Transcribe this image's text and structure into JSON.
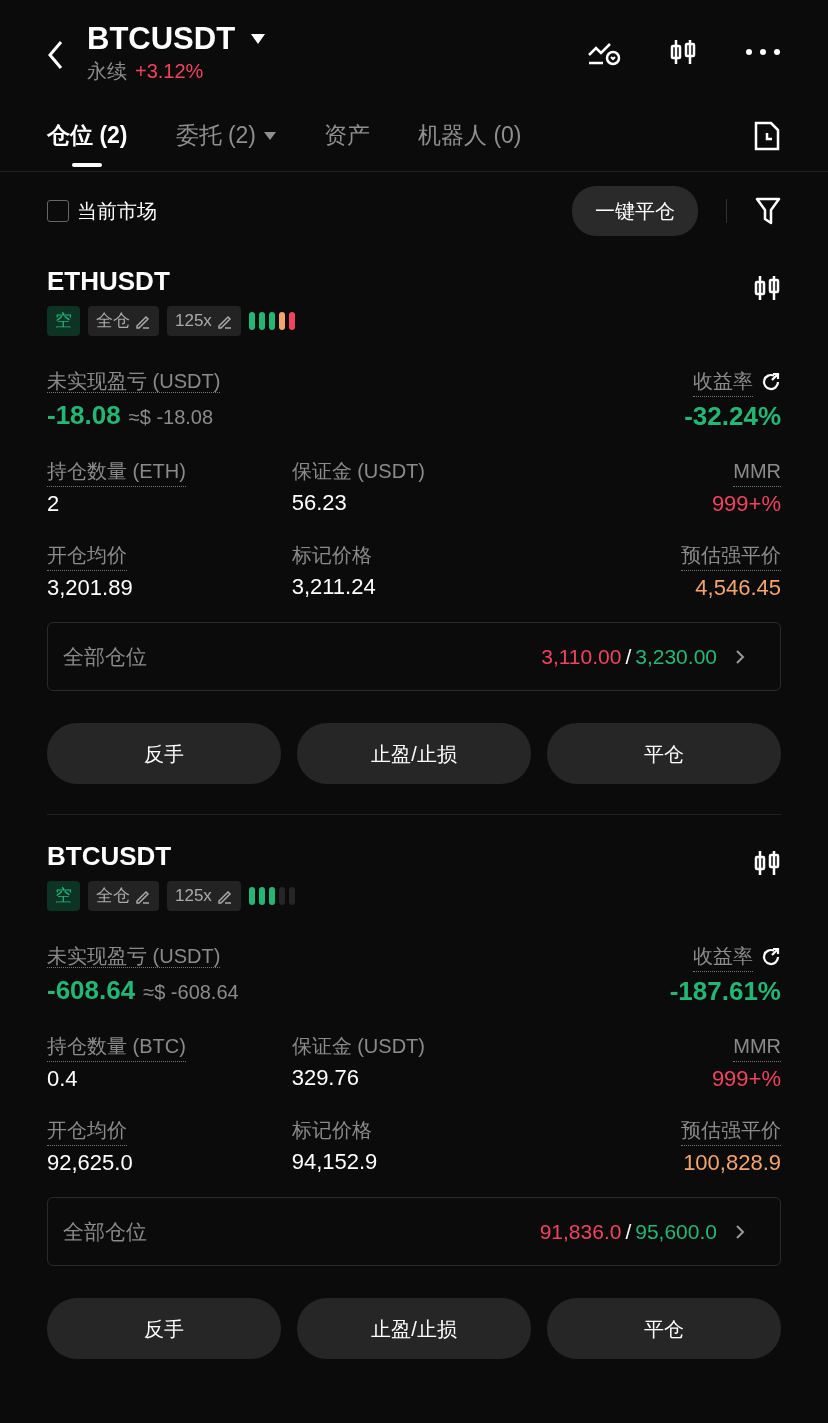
{
  "header": {
    "symbol": "BTCUSDT",
    "contract_type": "永续",
    "change": "+3.12%"
  },
  "tabs": [
    {
      "label": "仓位 (2)",
      "selected": true,
      "dropdown": false
    },
    {
      "label": "委托 (2)",
      "selected": false,
      "dropdown": true
    },
    {
      "label": "资产",
      "selected": false,
      "dropdown": false
    },
    {
      "label": "机器人 (0)",
      "selected": false,
      "dropdown": false
    }
  ],
  "filter_bar": {
    "checkbox_label": "当前市场",
    "checked": false,
    "close_all_button": "一键平仓"
  },
  "positions": [
    {
      "symbol": "ETHUSDT",
      "side": "空",
      "margin_mode": "全仓",
      "leverage": "125x",
      "risk_bars": [
        {
          "color": "#24b675"
        },
        {
          "color": "#24b675"
        },
        {
          "color": "#24b675"
        },
        {
          "color": "#f4a46e"
        },
        {
          "color": "#f0435f"
        }
      ],
      "pnl_label": "未实现盈亏 (USDT)",
      "pnl": "-18.08",
      "pnl_usd": "≈$ -18.08",
      "roe_label": "收益率",
      "roe": "-32.24%",
      "stats": [
        {
          "label": "持仓数量 (ETH)",
          "value": "2",
          "dotted": true,
          "color": "#ffffff"
        },
        {
          "label": "保证金 (USDT)",
          "value": "56.23",
          "dotted": false,
          "color": "#ffffff"
        },
        {
          "label": "MMR",
          "value": "999+%",
          "dotted": true,
          "color": "#f0435f"
        },
        {
          "label": "开仓均价",
          "value": "3,201.89",
          "dotted": true,
          "color": "#ffffff"
        },
        {
          "label": "标记价格",
          "value": "3,211.24",
          "dotted": false,
          "color": "#ffffff"
        },
        {
          "label": "预估强平价",
          "value": "4,546.45",
          "dotted": true,
          "color": "#f4a46e"
        }
      ],
      "range": {
        "label": "全部仓位",
        "low": "3,110.00",
        "separator": "/",
        "high": "3,230.00"
      },
      "buttons": [
        "反手",
        "止盈/止损",
        "平仓"
      ]
    },
    {
      "symbol": "BTCUSDT",
      "side": "空",
      "margin_mode": "全仓",
      "leverage": "125x",
      "risk_bars": [
        {
          "color": "#24b675"
        },
        {
          "color": "#24b675"
        },
        {
          "color": "#24b675"
        },
        {
          "color": "#262626"
        },
        {
          "color": "#262626"
        }
      ],
      "pnl_label": "未实现盈亏 (USDT)",
      "pnl": "-608.64",
      "pnl_usd": "≈$ -608.64",
      "roe_label": "收益率",
      "roe": "-187.61%",
      "stats": [
        {
          "label": "持仓数量 (BTC)",
          "value": "0.4",
          "dotted": true,
          "color": "#ffffff"
        },
        {
          "label": "保证金 (USDT)",
          "value": "329.76",
          "dotted": false,
          "color": "#ffffff"
        },
        {
          "label": "MMR",
          "value": "999+%",
          "dotted": true,
          "color": "#f0435f"
        },
        {
          "label": "开仓均价",
          "value": "92,625.0",
          "dotted": true,
          "color": "#ffffff"
        },
        {
          "label": "标记价格",
          "value": "94,152.9",
          "dotted": false,
          "color": "#ffffff"
        },
        {
          "label": "预估强平价",
          "value": "100,828.9",
          "dotted": true,
          "color": "#f4a46e"
        }
      ],
      "range": {
        "label": "全部仓位",
        "low": "91,836.0",
        "separator": "/",
        "high": "95,600.0"
      },
      "buttons": [
        "反手",
        "止盈/止损",
        "平仓"
      ]
    }
  ]
}
